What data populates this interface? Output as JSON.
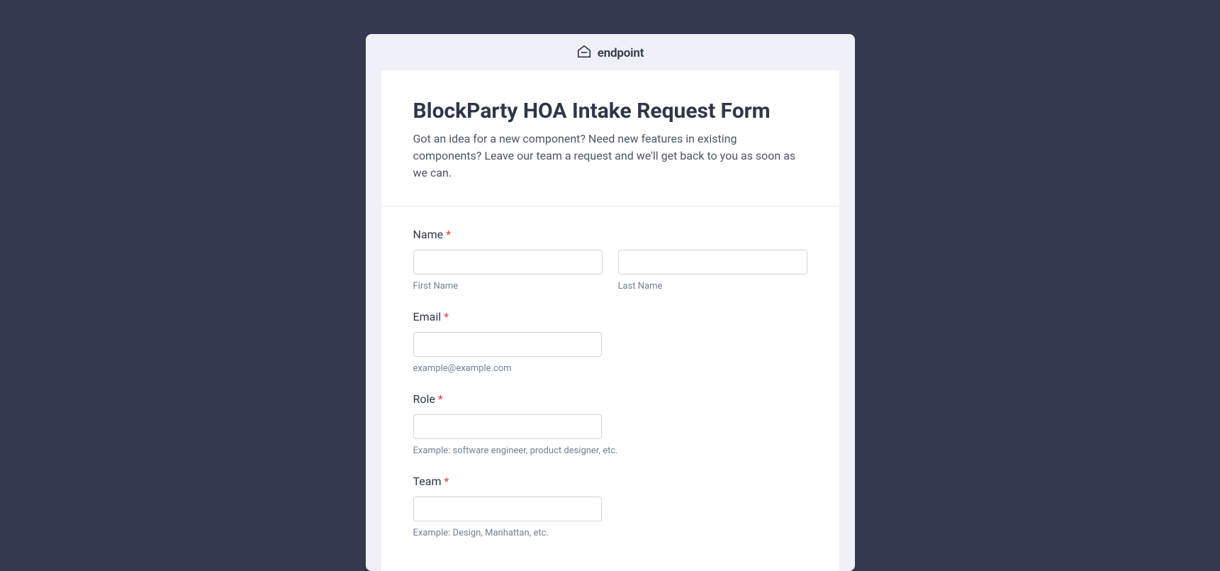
{
  "header": {
    "brand": "endpoint"
  },
  "form": {
    "title": "BlockParty HOA Intake Request Form",
    "description": "Got an idea for a new component? Need new features in existing components? Leave our team a request and we'll get back to you as soon as we can."
  },
  "fields": {
    "name": {
      "label": "Name",
      "required": "*",
      "firstName": {
        "value": "",
        "sublabel": "First Name"
      },
      "lastName": {
        "value": "",
        "sublabel": "Last Name"
      }
    },
    "email": {
      "label": "Email",
      "required": "*",
      "value": "",
      "sublabel": "example@example.com"
    },
    "role": {
      "label": "Role",
      "required": "*",
      "value": "",
      "sublabel": "Example: software engineer, product designer, etc."
    },
    "team": {
      "label": "Team",
      "required": "*",
      "value": "",
      "sublabel": "Example: Design, Manhattan, etc."
    }
  }
}
